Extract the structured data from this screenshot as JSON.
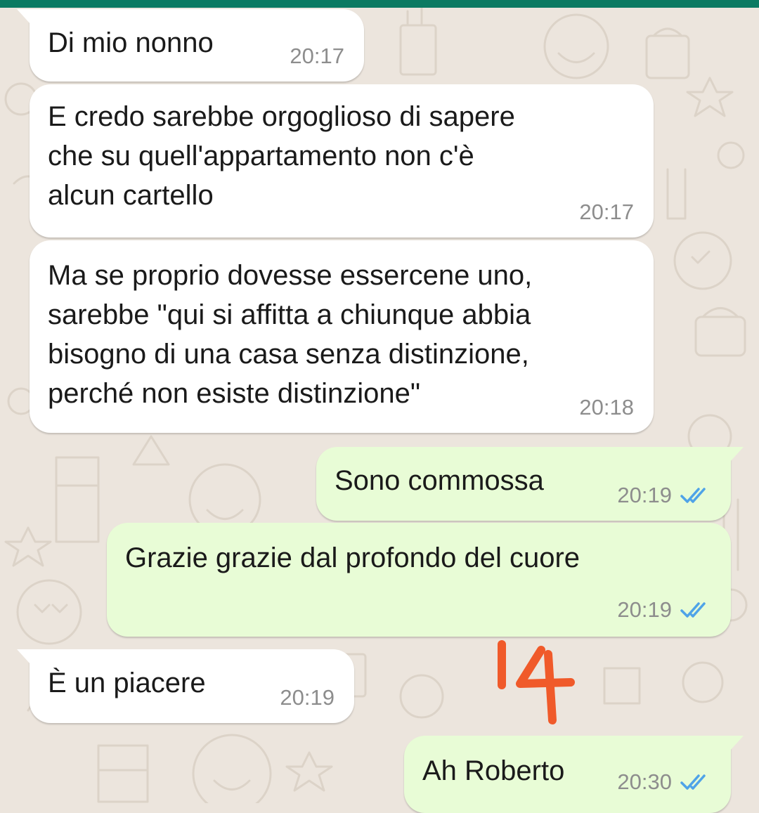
{
  "chat": {
    "messages": [
      {
        "direction": "incoming",
        "text": "Di mio nonno",
        "time": "20:17"
      },
      {
        "direction": "incoming",
        "text": "E credo sarebbe orgoglioso di sapere\nche su quell'appartamento non c'è\nalcun cartello",
        "time": "20:17"
      },
      {
        "direction": "incoming",
        "text": "Ma se proprio dovesse essercene uno,\nsarebbe \"qui si affitta a chiunque abbia\nbisogno di una casa senza distinzione,\nperché non esiste distinzione\"",
        "time": "20:18"
      },
      {
        "direction": "outgoing",
        "text": "Sono commossa",
        "time": "20:19",
        "status": "read"
      },
      {
        "direction": "outgoing",
        "text": "Grazie grazie dal profondo del cuore",
        "time": "20:19",
        "status": "read"
      },
      {
        "direction": "incoming",
        "text": "È un piacere",
        "time": "20:19"
      },
      {
        "direction": "outgoing",
        "text": "Ah Roberto",
        "time": "20:30",
        "status": "read"
      }
    ]
  },
  "colors": {
    "header": "#0b7a62",
    "wallpaper": "#ece5dd",
    "incoming_bubble": "#ffffff",
    "outgoing_bubble": "#e8fcd6",
    "read_ticks": "#4fa3e8",
    "annotation": "#f05a2a"
  },
  "annotation": {
    "text": "14"
  },
  "icons": {
    "read_receipt": "double-check-icon"
  }
}
